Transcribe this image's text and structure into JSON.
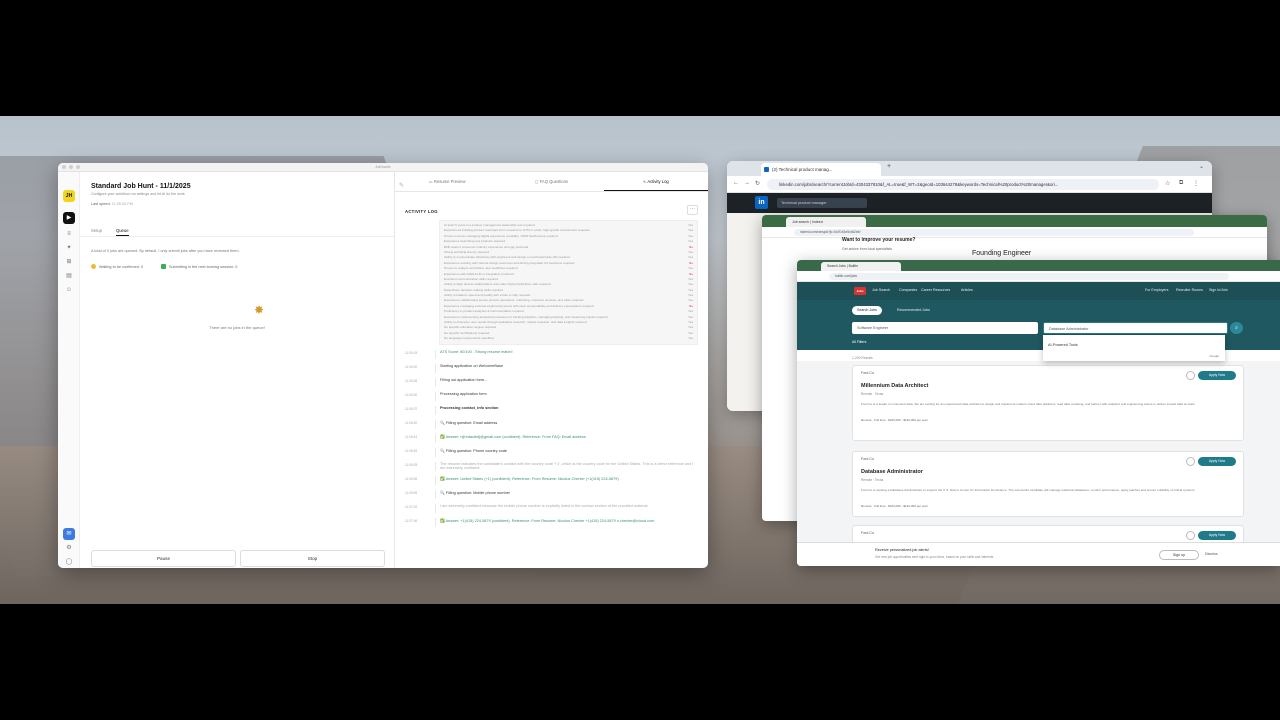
{
  "app": {
    "window_title": "Jobhuntr",
    "logo": "JH",
    "job_title": "Standard Job Hunt - 11/1/2025",
    "subtitle": "Configure your workflow run settings and let AI do the work",
    "last_speed": "Last speed:",
    "last_speed_value": "11:05:26 PM",
    "tabs": [
      "Setup",
      "Queue"
    ],
    "queue_info": "A total of 0 jobs are queued. By default, I only submit jobs after you have reviewed them.",
    "waiting": "Waiting to be confirmed: 0",
    "submitting": "Submitting in the next burning session: 0",
    "empty": "There are no jobs in the queue!",
    "pause": "Pause",
    "stop": "Stop",
    "right_tabs": [
      "Resume Preview",
      "FAQ Questions",
      "Activity Log"
    ],
    "log_heading": "ACTIVITY LOG",
    "more": "···",
    "requirements": [
      {
        "t": "At least 5 years in a product management leadership role required",
        "v": "Yes"
      },
      {
        "t": "Experienced building product roadmaps from research to GTM in a fast, high-growth environment required",
        "v": "Yes"
      },
      {
        "t": "Proven success managing digital experience (modality: 100% SaaS team) required",
        "v": "Yes"
      },
      {
        "t": "Experience launching new products required",
        "v": "Yes"
      },
      {
        "t": "B2B retail or consumer industry experience strongly preferred",
        "v": "No"
      },
      {
        "t": "Strong technical fluency required",
        "v": "Yes"
      },
      {
        "t": "Ability to communicate effectively with engineers and design on technical trade-offs required",
        "v": "Yes"
      },
      {
        "t": "Experience working with internal design resources and driving pragmatic UX decisions required",
        "v": "No"
      },
      {
        "t": "Proven to analyze and define user workflows required",
        "v": "Yes"
      },
      {
        "t": "Experience with AI/ML/LLM or integration preferred",
        "v": "No"
      },
      {
        "t": "Excellent communication skills required",
        "v": "Yes"
      },
      {
        "t": "Ability to align diverse stakeholders and make high-prioritization calls required",
        "v": "Yes"
      },
      {
        "t": "Data-driven decision-making skills required",
        "v": "Yes"
      },
      {
        "t": "Ability to balance speed and quality with a bias to ship required",
        "v": "Yes"
      },
      {
        "t": "Experience collaborating across product operations, marketing, customer success, and sales required",
        "v": "Yes"
      },
      {
        "t": "Experience managing external engineering teams with clear accountability and delivery expectations required",
        "v": "No"
      },
      {
        "t": "Proficiency in product analytics & instrumentation required",
        "v": "Yes"
      },
      {
        "t": "Experience implementing analytical processes for tracking adoption, managing backlog, and measuring impact required",
        "v": "Yes"
      },
      {
        "t": "Ability to champion user needs through qualitative research, market research, and data insights required",
        "v": "Yes"
      },
      {
        "t": "No specific education degree required",
        "v": "Yes"
      },
      {
        "t": "No specific certifications required",
        "v": "Yes"
      },
      {
        "t": "No language requirements specified",
        "v": "Yes"
      }
    ],
    "entries": [
      {
        "ts": "11:06:19",
        "text": "ATS Score: 80/100 - Strong resume match!",
        "style": "green"
      },
      {
        "ts": "11:06:20",
        "text": "Starting application on WelcomeBase",
        "style": ""
      },
      {
        "ts": "11:06:28",
        "text": "Filling out application form...",
        "style": ""
      },
      {
        "ts": "11:06:30",
        "text": "Processing application form",
        "style": ""
      },
      {
        "ts": "11:06:37",
        "text": "Processing contact_info section",
        "style": "bold"
      },
      {
        "ts": "11:06:40",
        "text": "🔍 Filling question: Email address",
        "style": ""
      },
      {
        "ts": "11:06:43",
        "text": "✅ Answer: ni[redacted]@gmail.com (confident). Reference: From FAQ: Email address",
        "style": "green"
      },
      {
        "ts": "11:06:49",
        "text": "🔍 Filling question: Phone country code",
        "style": ""
      },
      {
        "ts": "11:06:53",
        "text": "The resume indicates the candidate's contact with the country code '+1', which is the country code for the United States. This is a direct reference and I am extremely confident.",
        "style": "grey"
      },
      {
        "ts": "11:06:56",
        "text": "✅ Answer: United States (+1) (confident). Reference: From Resume: Nicolus Chenier (+1(415) 224-5879)",
        "style": "green"
      },
      {
        "ts": "11:06:59",
        "text": "🔍 Filling question: Mobile phone number",
        "style": ""
      },
      {
        "ts": "11:07:02",
        "text": "I am extremely confident because the mobile phone number is explicitly listed in the contact section of the provided material.",
        "style": "grey"
      },
      {
        "ts": "11:07:06",
        "text": "✅ Answer: +1(415) 224-5879 (confident). Reference: From Resume: Nicolus Chenier +1(415) 224-5879 n.chenier@icloud.com",
        "style": "green"
      }
    ]
  },
  "chrome": {
    "tab": "(2) Technical product manag...",
    "url": "linkedin.com/jobs/search/?currentJobId=4304337810&f_AL=true&f_WT=2&geoId=103644278&keywords=Technical%20product%20manager&ori...",
    "search": "Technical product manager",
    "logo": "in"
  },
  "win2": {
    "tab": "Job search | Indeed",
    "url": "indeed.com/viewjob?jk=0a7f1b3e5c9d2e4f",
    "improve": "Want to improve your resume?",
    "improve_sub": "Get advice from local specialists",
    "founding": "Founding Engineer"
  },
  "win3": {
    "tab": "Search Jobs | BuiltIn",
    "url": "builtin.com/jobs",
    "nav": [
      "Jobs",
      "Job Search",
      "Companies",
      "Career Resources",
      "Articles"
    ],
    "nav_right": [
      "For Employers",
      "Recruiter Rooms",
      "Sign In/Join"
    ],
    "pill": "Search Jobs",
    "pill2": "Recommended Jobs",
    "in1": "Software Engineer",
    "in2": "Database Administrator",
    "all": "All Filters",
    "drop": "AI-Powered Tools",
    "google": "Google",
    "count": "1,200 Results",
    "jobs": [
      {
        "company": "Ford Co",
        "title": "Millennium Data Architect",
        "loc": "Remote · Texas",
        "desc": "Ford Co is a leader in connected data. We are looking for an experienced data architect to design and implement modern cloud data platforms, lead data modeling, and partner with analytics and engineering teams to deliver trusted data at scale.",
        "meta": "Remote · Full time · $160,000 - $190,000 per year",
        "apply": "Apply Now"
      },
      {
        "company": "Ford Co",
        "title": "Database Administrator",
        "loc": "Remote · Texas",
        "desc": "Ford Co is seeking a Database Administrator to support the U.S. Navy's Center for Information Dominance. The successful candidate will manage relational databases, monitor performance, apply patches and ensure reliability of critical systems.",
        "meta": "Remote · Full time · $100,000 - $120,000 per year",
        "apply": "Apply Now"
      },
      {
        "company": "Ford Co",
        "title": "",
        "loc": "",
        "desc": "",
        "meta": "",
        "apply": "Apply Now"
      }
    ],
    "banner_title": "Receive personalized job alerts!",
    "banner_sub": "Get new job opportunities sent right to your inbox, based on your skills and interests.",
    "signup": "Sign up",
    "dismiss": "Dismiss"
  }
}
